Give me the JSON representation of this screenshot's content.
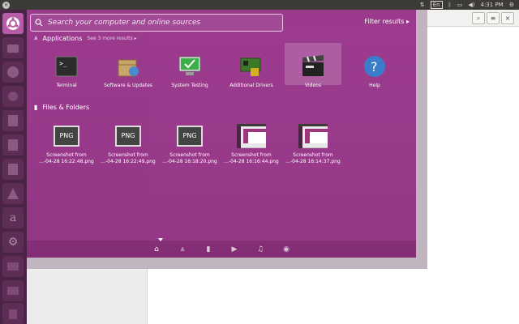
{
  "topbar": {
    "keyboard": "En",
    "time": "4:31 PM"
  },
  "search": {
    "placeholder": "Search your computer and online sources",
    "filter_label": "Filter results"
  },
  "applications": {
    "heading": "Applications",
    "more": "See 3 more results",
    "items": [
      {
        "label": "Terminal",
        "icon": "terminal-icon"
      },
      {
        "label": "Software & Updates",
        "icon": "software-updates-icon"
      },
      {
        "label": "System Testing",
        "icon": "system-testing-icon"
      },
      {
        "label": "Additional Drivers",
        "icon": "additional-drivers-icon"
      },
      {
        "label": "Videos",
        "icon": "videos-icon"
      },
      {
        "label": "Help",
        "icon": "help-icon"
      }
    ]
  },
  "files": {
    "heading": "Files & Folders",
    "items": [
      {
        "line1": "Screenshot from",
        "line2": "...-04-28 16:22:48.png",
        "icon": "png-file-icon"
      },
      {
        "line1": "Screenshot from",
        "line2": "...-04-28 16:22:49.png",
        "icon": "png-file-icon"
      },
      {
        "line1": "Screenshot from",
        "line2": "...-04-28 16:18:20.png",
        "icon": "png-file-icon"
      },
      {
        "line1": "Screenshot from",
        "line2": "...-04-28 16:16:44.png",
        "icon": "screenshot-thumbnail-icon"
      },
      {
        "line1": "Screenshot from",
        "line2": "...-04-28 16:14:37.png",
        "icon": "screenshot-thumbnail-icon"
      }
    ]
  },
  "png_badge": "PNG",
  "colors": {
    "dash": "#962d87",
    "launcher": "#4a2345",
    "topbar": "#3c3b37"
  }
}
